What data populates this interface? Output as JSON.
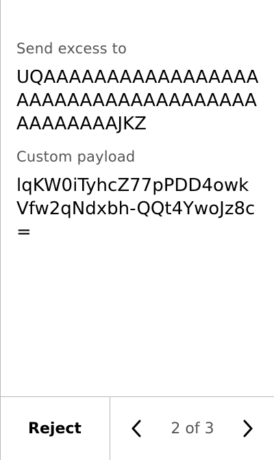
{
  "fields": [
    {
      "label": "Send excess to",
      "value": "UQAAAAAAAAAAAAAAAAAAAAAAAAAAAAAAAAAAAAAAAAAAAAJKZ"
    },
    {
      "label": "Custom payload",
      "value": "lqKW0iTyhcZ77pPDD4owkVfw2qNdxbh-QQt4YwoJz8c="
    }
  ],
  "footer": {
    "reject_label": "Reject",
    "page_indicator": "2 of 3",
    "prev_icon": "chevron-left-icon",
    "next_icon": "chevron-right-icon"
  }
}
